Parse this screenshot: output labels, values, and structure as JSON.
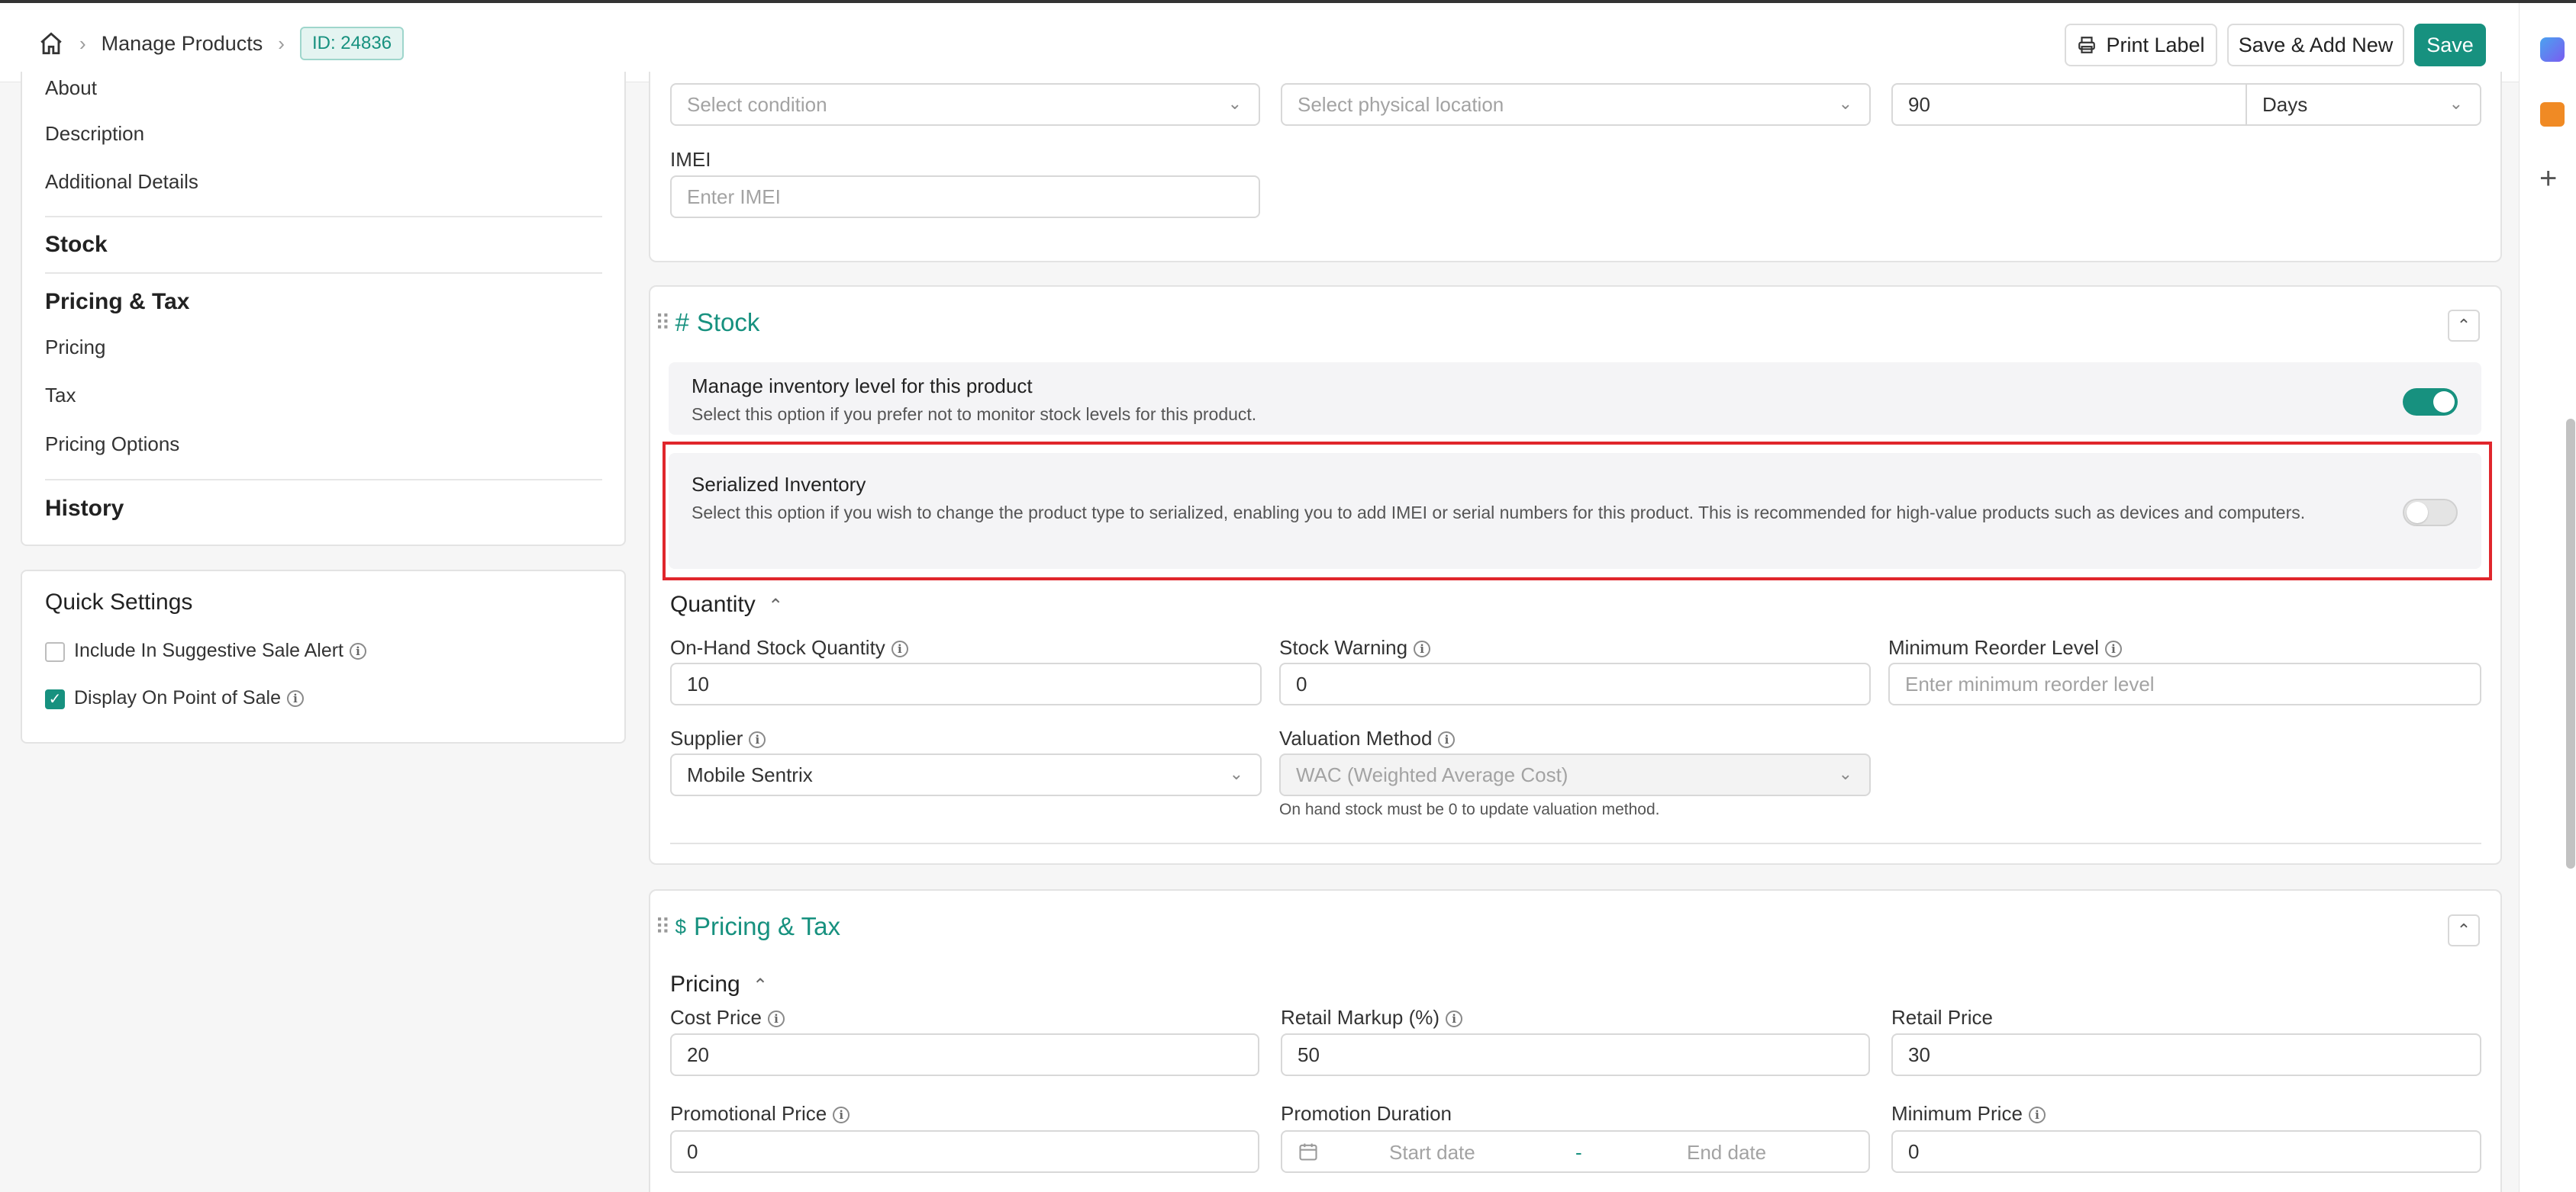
{
  "header": {
    "breadcrumb": "Manage Products",
    "id_badge": "ID: 24836",
    "print_label": "Print Label",
    "save_add_new": "Save & Add New",
    "save": "Save"
  },
  "sidebar": {
    "items_top": [
      "About",
      "Description",
      "Additional Details"
    ],
    "stock": "Stock",
    "pricing_tax": "Pricing & Tax",
    "pricing_items": [
      "Pricing",
      "Tax",
      "Pricing Options"
    ],
    "history": "History"
  },
  "quick_settings": {
    "title": "Quick Settings",
    "options": [
      {
        "label": "Include In Suggestive Sale Alert",
        "checked": false
      },
      {
        "label": "Display On Point of Sale",
        "checked": true
      }
    ]
  },
  "top_fields": {
    "condition_placeholder": "Select condition",
    "location_placeholder": "Select physical location",
    "warranty_value": "90",
    "warranty_unit": "Days",
    "imei_label": "IMEI",
    "imei_placeholder": "Enter IMEI"
  },
  "stock": {
    "title": "Stock",
    "title_prefix": "#",
    "manage_title": "Manage inventory level for this product",
    "manage_desc": "Select this option if you prefer not to monitor stock levels for this product.",
    "manage_on": true,
    "serialized_title": "Serialized Inventory",
    "serialized_desc": "Select this option if you wish to change the product type to serialized, enabling you to add IMEI or serial numbers for this product. This is recommended for high-value products such as devices and computers.",
    "serialized_on": false,
    "quantity_title": "Quantity",
    "on_hand_label": "On-Hand Stock Quantity",
    "on_hand_value": "10",
    "stock_warning_label": "Stock Warning",
    "stock_warning_value": "0",
    "min_reorder_label": "Minimum Reorder Level",
    "min_reorder_placeholder": "Enter minimum reorder level",
    "supplier_label": "Supplier",
    "supplier_value": "Mobile Sentrix",
    "valuation_label": "Valuation Method",
    "valuation_value": "WAC (Weighted Average Cost)",
    "valuation_note": "On hand stock must be 0 to update valuation method."
  },
  "pricing_tax": {
    "title": "Pricing & Tax",
    "title_prefix": "$",
    "pricing_title": "Pricing",
    "cost_label": "Cost Price",
    "cost_value": "20",
    "markup_label": "Retail Markup (%)",
    "markup_value": "50",
    "retail_label": "Retail Price",
    "retail_value": "30",
    "promo_label": "Promotional Price",
    "promo_value": "0",
    "duration_label": "Promotion Duration",
    "start_placeholder": "Start date",
    "end_placeholder": "End date",
    "date_sep": "-",
    "min_price_label": "Minimum Price",
    "min_price_value": "0"
  },
  "colors": {
    "accent": "#17917f",
    "highlight": "#e0262c"
  }
}
